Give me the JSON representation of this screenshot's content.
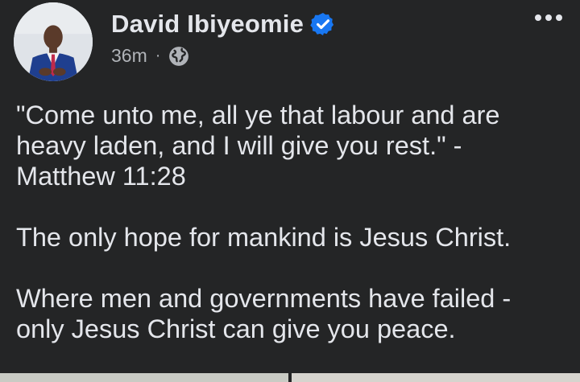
{
  "post": {
    "author": {
      "name": "David Ibiyeomie",
      "verified": true
    },
    "timestamp": "36m",
    "separator": "·",
    "audience_icon": "globe-icon",
    "more_icon": "more-options-icon",
    "paragraphs": [
      "\"Come unto me, all ye that labour and are heavy laden, and I will give you rest.\" - Matthew 11:28",
      "The only hope for mankind is Jesus Christ.",
      "Where men and governments have failed - only Jesus Christ can give you peace."
    ]
  },
  "colors": {
    "background": "#242526",
    "text_primary": "#e4e6eb",
    "text_secondary": "#b0b3b8",
    "verified_badge": "#1877f2"
  }
}
